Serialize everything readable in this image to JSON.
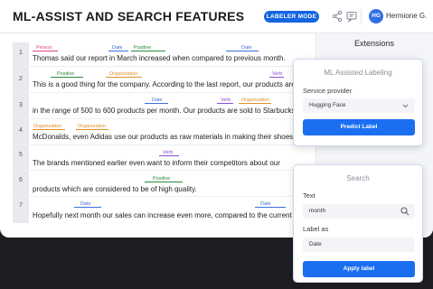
{
  "header": {
    "title": "ML-ASSIST AND SEARCH FEATURES",
    "mode_badge": "LABELER MODE",
    "user_initials": "HG",
    "user_name": "Hermione G."
  },
  "editor": {
    "lines": [
      {
        "number": "1",
        "text": "Thomas said our report in March increased when compared to previous month."
      },
      {
        "number": "2",
        "text": "This is a good thing for the company. According to the last report, our products are sold"
      },
      {
        "number": "3",
        "text": "in the range of 500 to 600 products per month. Our products are sold to Starbucks,"
      },
      {
        "number": "4",
        "text": "McDonalds, even Adidas use our products as raw materials in making their shoes."
      },
      {
        "number": "5",
        "text": "The brands mentioned earlier even want to inform their competitors about our"
      },
      {
        "number": "6",
        "text": "products which are considered to be of high quality."
      },
      {
        "number": "7",
        "text": "Hopefully next month our sales can increase even more, compared to the current month."
      }
    ],
    "labels": [
      {
        "text": "Person",
        "color": "#d9468a"
      },
      {
        "text": "Date",
        "color": "#3d6fd8"
      },
      {
        "text": "Positive",
        "color": "#2a8a3c"
      },
      {
        "text": "Date",
        "color": "#3d6fd8"
      },
      {
        "text": "Positive",
        "color": "#2a8a3c"
      },
      {
        "text": "Organization",
        "color": "#e0902a"
      },
      {
        "text": "Verb",
        "color": "#8a4fd6"
      },
      {
        "text": "Date",
        "color": "#3d6fd8"
      },
      {
        "text": "Verb",
        "color": "#8a4fd6"
      },
      {
        "text": "Organization",
        "color": "#e0902a"
      },
      {
        "text": "Organization",
        "color": "#e0902a"
      },
      {
        "text": "Organization",
        "color": "#e0902a"
      },
      {
        "text": "Verb",
        "color": "#8a4fd6"
      },
      {
        "text": "Positive",
        "color": "#2a8a3c"
      },
      {
        "text": "Date",
        "color": "#3d6fd8"
      },
      {
        "text": "Date",
        "color": "#3d6fd8"
      }
    ]
  },
  "extensions": {
    "title": "Extensions"
  },
  "ml_card": {
    "title": "ML Assisted Labeling",
    "provider_label": "Service provider",
    "provider_value": "Hugging Face",
    "button": "Predict Label"
  },
  "search_card": {
    "title": "Search",
    "text_label": "Text",
    "text_value": "month",
    "label_as_label": "Label as",
    "label_as_value": "Date",
    "button": "Apply label"
  },
  "colors": {
    "accent": "#1a6ef0",
    "person": "#d9468a",
    "date": "#3d6fd8",
    "positive": "#2a8a3c",
    "organization": "#e0902a",
    "verb": "#8a4fd6"
  }
}
